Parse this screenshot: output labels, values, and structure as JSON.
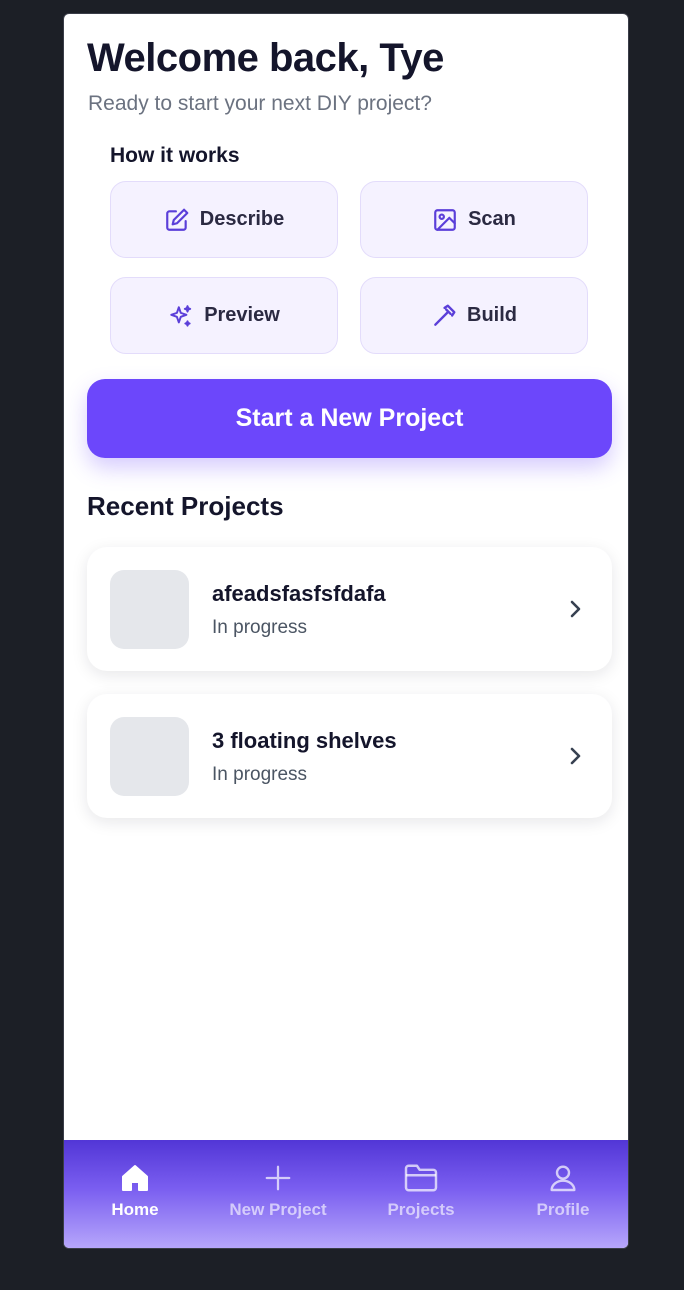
{
  "header": {
    "greeting": "Welcome back, Tye",
    "subtitle": "Ready to start your next DIY project?"
  },
  "how_it_works": {
    "title": "How it works",
    "steps": [
      {
        "label": "Describe",
        "icon": "edit-icon"
      },
      {
        "label": "Scan",
        "icon": "image-icon"
      },
      {
        "label": "Preview",
        "icon": "sparkles-icon"
      },
      {
        "label": "Build",
        "icon": "hammer-icon"
      }
    ]
  },
  "cta": {
    "label": "Start a New Project"
  },
  "recent": {
    "title": "Recent Projects",
    "projects": [
      {
        "name": "afeadsfasfsfdafa",
        "status": "In progress"
      },
      {
        "name": "3 floating shelves",
        "status": "In progress"
      }
    ]
  },
  "tabbar": {
    "tabs": [
      {
        "label": "Home",
        "icon": "home-icon",
        "active": true
      },
      {
        "label": "New Project",
        "icon": "plus-icon",
        "active": false
      },
      {
        "label": "Projects",
        "icon": "folder-icon",
        "active": false
      },
      {
        "label": "Profile",
        "icon": "user-icon",
        "active": false
      }
    ]
  },
  "colors": {
    "accent": "#6c47fb",
    "step_bg": "#f5f2ff",
    "step_border": "#e3dcfb",
    "icon": "#5b3fd9",
    "thumb": "#e5e7eb"
  }
}
